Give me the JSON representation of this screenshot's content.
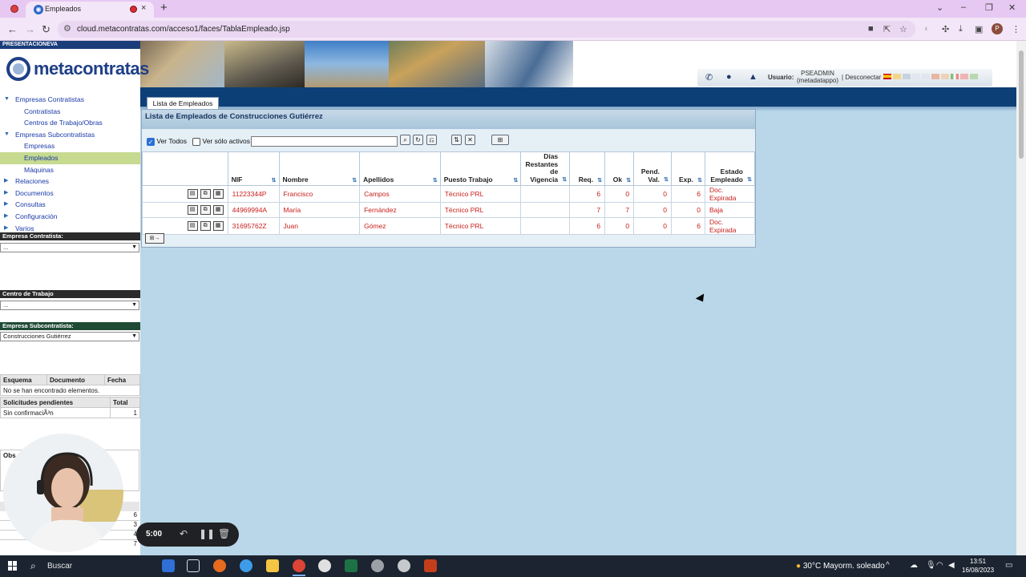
{
  "browser": {
    "tab_title": "Empleados",
    "url": "cloud.metacontratas.com/acceso1/faces/TablaEmpleado.jsp"
  },
  "header": {
    "presentation_label": "PRESENTACIONEVA",
    "logo_text": "metacontratas",
    "small_logo_text": "metacontratas",
    "user_label": "Usuario:",
    "user_name": "PSEADMIN",
    "user_org": "(metadatappo)",
    "disconnect_label": "Desconectar"
  },
  "menu": {
    "items": [
      {
        "label": "Empresas Contratistas",
        "level": 0,
        "expanded": true
      },
      {
        "label": "Contratistas",
        "level": 1
      },
      {
        "label": "Centros de Trabajo/Obras",
        "level": 1
      },
      {
        "label": "Empresas Subcontratistas",
        "level": 0,
        "expanded": true
      },
      {
        "label": "Empresas",
        "level": 1
      },
      {
        "label": "Empleados",
        "level": 1,
        "selected": true
      },
      {
        "label": "Máquinas",
        "level": 1
      },
      {
        "label": "Relaciones",
        "level": 0
      },
      {
        "label": "Documentos",
        "level": 0
      },
      {
        "label": "Consultas",
        "level": 0
      },
      {
        "label": "Configuración",
        "level": 0
      },
      {
        "label": "Varios",
        "level": 0
      }
    ]
  },
  "sidebar": {
    "contratista_label": "Empresa Contratista:",
    "contratista_value": "...",
    "centro_label": "Centro de Trabajo",
    "centro_value": "...",
    "subcontratista_label": "Empresa Subcontratista:",
    "subcontratista_value": "Construcciones Gutiérrez",
    "docs_headers": [
      "Esquema",
      "Documento",
      "Fecha"
    ],
    "docs_empty": "No se han encontrado elementos.",
    "pending_headers": [
      "Solicitudes pendientes",
      "Total"
    ],
    "pending_row": [
      "Sin confirmaciÃ³n",
      "1"
    ],
    "obs_label": "Obs",
    "partial_numbers": [
      "6",
      "3",
      "4",
      "7"
    ]
  },
  "main": {
    "tab_label": "Lista de Empleados",
    "panel_title": "Lista de Empleados de Construcciones Gutiérrez",
    "ver_todos_label": "Ver Todos",
    "ver_activos_label": "Ver sólo activos |",
    "filter_value": "",
    "columns": [
      "NIF",
      "Nombre",
      "Apellidos",
      "Puesto Trabajo",
      "Días Restantes de Vigencia",
      "Req.",
      "Ok",
      "Pend. Val.",
      "Exp.",
      "Estado Empleado"
    ],
    "rows": [
      {
        "nif": "11223344P",
        "nombre": "Francisco",
        "apellidos": "Campos",
        "puesto": "Técnico PRL",
        "dias": "",
        "req": "6",
        "ok": "0",
        "pend": "0",
        "exp": "6",
        "estado": "Doc. Expirada"
      },
      {
        "nif": "44969994A",
        "nombre": "María",
        "apellidos": "Fernández",
        "puesto": "Técnico PRL",
        "dias": "",
        "req": "7",
        "ok": "7",
        "pend": "0",
        "exp": "0",
        "estado": "Baja"
      },
      {
        "nif": "31695762Z",
        "nombre": "Juan",
        "apellidos": "Gómez",
        "puesto": "Técnico PRL",
        "dias": "",
        "req": "6",
        "ok": "0",
        "pend": "0",
        "exp": "6",
        "estado": "Doc. Expirada"
      }
    ]
  },
  "recorder": {
    "time": "5:00"
  },
  "taskbar": {
    "search_label": "Buscar",
    "weather": "30°C  Mayorm. soleado",
    "time": "13:51",
    "date": "16/08/2023"
  }
}
